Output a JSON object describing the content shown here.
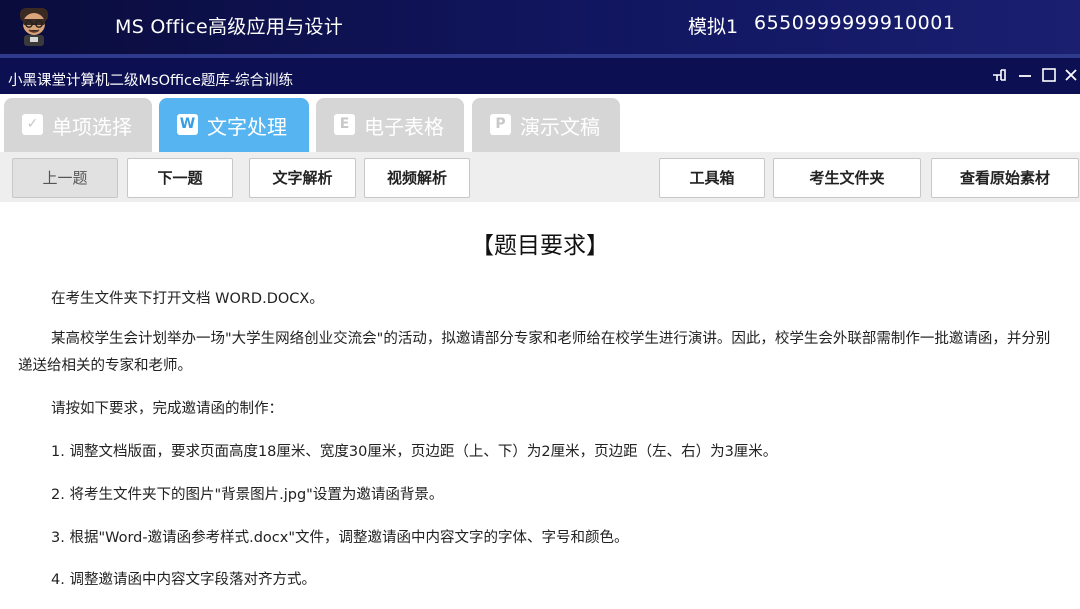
{
  "banner": {
    "title": "MS Office高级应用与设计",
    "exam_label": "模拟1",
    "exam_id": "6550999999910001"
  },
  "window": {
    "title": "小黑课堂计算机二级MsOffice题库-综合训练",
    "controls": [
      "pin-icon",
      "minimize-icon",
      "maximize-icon",
      "close-icon"
    ]
  },
  "tabs": [
    {
      "icon": "checkbox-icon",
      "icon_glyph": "✓",
      "label": "单项选择",
      "active": false
    },
    {
      "icon": "word-icon",
      "icon_glyph": "W",
      "label": "文字处理",
      "active": true
    },
    {
      "icon": "excel-icon",
      "icon_glyph": "E",
      "label": "电子表格",
      "active": false
    },
    {
      "icon": "ppt-icon",
      "icon_glyph": "P",
      "label": "演示文稿",
      "active": false
    }
  ],
  "toolbar": {
    "prev": "上一题",
    "next": "下一题",
    "text_analysis": "文字解析",
    "video_analysis": "视频解析",
    "toolbox": "工具箱",
    "student_folder": "考生文件夹",
    "view_material": "查看原始素材"
  },
  "content": {
    "heading": "【题目要求】",
    "paragraphs": [
      "在考生文件夹下打开文档 WORD.DOCX。",
      "某高校学生会计划举办一场\"大学生网络创业交流会\"的活动，拟邀请部分专家和老师给在校学生进行演讲。因此，校学生会外联部需制作一批邀请函，并分别递送给相关的专家和老师。",
      "请按如下要求，完成邀请函的制作：",
      "1. 调整文档版面，要求页面高度18厘米、宽度30厘米，页边距（上、下）为2厘米，页边距（左、右）为3厘米。",
      "2. 将考生文件夹下的图片\"背景图片.jpg\"设置为邀请函背景。",
      "3. 根据\"Word-邀请函参考样式.docx\"文件，调整邀请函中内容文字的字体、字号和颜色。",
      "4. 调整邀请函中内容文字段落对齐方式。"
    ]
  },
  "colors": {
    "banner": "#0a0c3c",
    "active_tab": "#56b4f0",
    "inactive_tab": "#d6d6d6",
    "toolbar_bg": "#eeeeee"
  }
}
